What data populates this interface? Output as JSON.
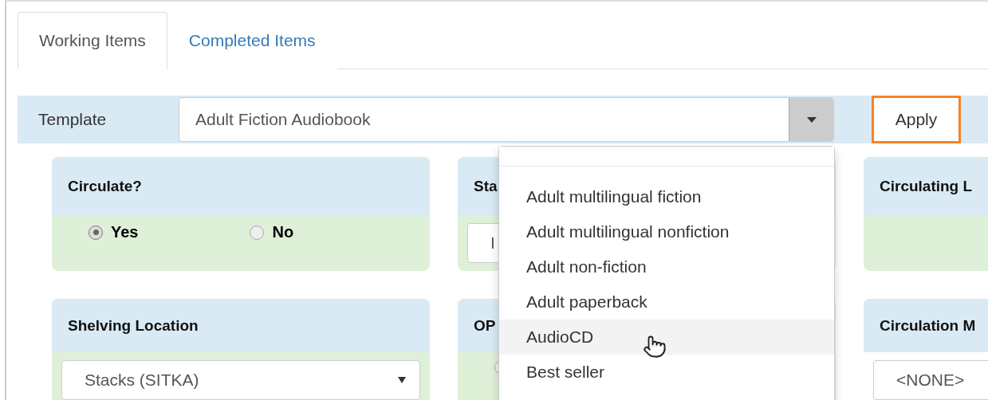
{
  "tabs": [
    {
      "label": "Working Items",
      "selected": true
    },
    {
      "label": "Completed Items",
      "selected": false
    }
  ],
  "template": {
    "label": "Template",
    "value": "Adult Fiction Audiobook",
    "apply": "Apply"
  },
  "dropdown": {
    "items": [
      {
        "kind": "blank",
        "selected": false
      },
      {
        "label": "Adult multilingual fiction",
        "selected": false
      },
      {
        "label": "Adult multilingual nonfiction",
        "selected": false
      },
      {
        "label": "Adult non-fiction",
        "selected": false
      },
      {
        "label": "Adult paperback",
        "selected": false
      },
      {
        "label": "AudioCD",
        "selected": true
      },
      {
        "label": "Best seller",
        "selected": false
      }
    ]
  },
  "cards": [
    {
      "title": "Circulate?",
      "kind": "radios",
      "options": [
        {
          "label": "Yes",
          "selected": true
        },
        {
          "label": "No",
          "selected": false
        }
      ]
    },
    {
      "title": "Sta",
      "kind": "input",
      "value": "I"
    },
    {
      "title": "Circulating L",
      "kind": "empty"
    },
    {
      "title": "Shelving Location",
      "kind": "select",
      "value": "Stacks (SITKA)"
    },
    {
      "title": "OP",
      "kind": "radio-stub",
      "selected": false
    },
    {
      "title": "Circulation M",
      "kind": "input",
      "value": "<NONE>"
    }
  ]
}
